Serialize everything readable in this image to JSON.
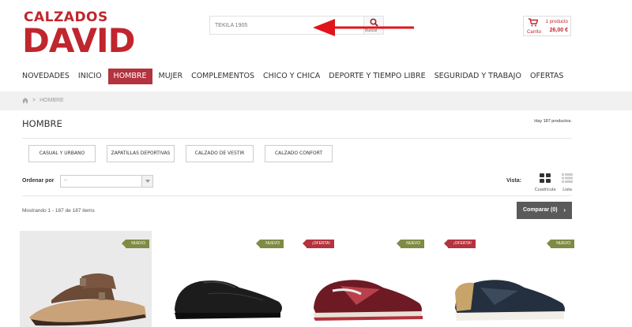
{
  "brand": {
    "line1": "CALZADOS",
    "line2": "DAVID",
    "color": "#c0262d"
  },
  "search": {
    "value": "TEKILA 1905",
    "button_label": "Buscar"
  },
  "cart": {
    "label": "Carrito",
    "count": "1 producto",
    "total": "26,00 €"
  },
  "nav": {
    "items": [
      {
        "label": "NOVEDADES"
      },
      {
        "label": "INICIO"
      },
      {
        "label": "HOMBRE",
        "active": true
      },
      {
        "label": "MUJER"
      },
      {
        "label": "COMPLEMENTOS"
      },
      {
        "label": "CHICO Y CHICA"
      },
      {
        "label": "DEPORTE Y TIEMPO LIBRE"
      },
      {
        "label": "SEGURIDAD Y TRABAJO"
      },
      {
        "label": "OFERTAS"
      }
    ]
  },
  "breadcrumb": {
    "current": "HOMBRE"
  },
  "page": {
    "title": "HOMBRE",
    "product_count": "Hay 187 productos."
  },
  "subcategories": [
    {
      "label": "CASUAL Y URBANO"
    },
    {
      "label": "ZAPATILLAS DEPORTIVAS"
    },
    {
      "label": "CALZADO DE VESTIR"
    },
    {
      "label": "CALZADO CONFORT"
    }
  ],
  "sort": {
    "label": "Ordenar por",
    "value": "--"
  },
  "view": {
    "label": "Vista:",
    "grid_label": "Cuadrícula",
    "list_label": "Lista"
  },
  "listing": {
    "showing": "Mostrando 1 - 187 de 187 items",
    "compare_label": "Comparar (0)"
  },
  "products": [
    {
      "badge": "NUEVO",
      "badge_type": "new",
      "image": "brown-sandal"
    },
    {
      "badge": "NUEVO",
      "badge_type": "new",
      "image": "black-dress-shoe"
    },
    {
      "badge": "¡OFERTA!",
      "badge_type": "offer",
      "image": "burgundy-sneaker"
    },
    {
      "badge": "NUEVO",
      "badge_type": "new",
      "image": "navy-sneaker"
    }
  ],
  "product_badges_right": [
    "NUEVO",
    "NUEVO",
    "NUEVO",
    "NUEVO"
  ],
  "colors": {
    "accent": "#b3333e",
    "badge_new": "#7f8a44",
    "badge_offer": "#b3333e",
    "annotation_arrow": "#e0141a"
  }
}
